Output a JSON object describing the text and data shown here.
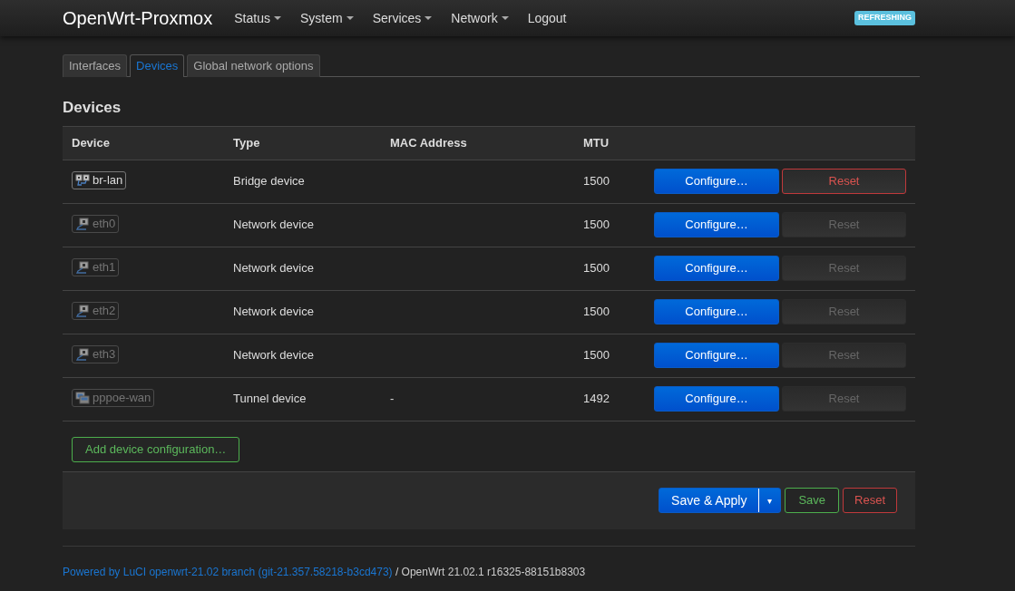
{
  "header": {
    "brand": "OpenWrt-Proxmox",
    "menu": [
      {
        "label": "Status",
        "dropdown": true
      },
      {
        "label": "System",
        "dropdown": true
      },
      {
        "label": "Services",
        "dropdown": true
      },
      {
        "label": "Network",
        "dropdown": true
      },
      {
        "label": "Logout",
        "dropdown": false
      }
    ],
    "badge": "REFRESHING"
  },
  "tabs": [
    {
      "label": "Interfaces",
      "selected": false
    },
    {
      "label": "Devices",
      "selected": true
    },
    {
      "label": "Global network options",
      "selected": false
    }
  ],
  "section_title": "Devices",
  "table": {
    "columns": [
      "Device",
      "Type",
      "MAC Address",
      "MTU"
    ],
    "rows": [
      {
        "device": "br-lan",
        "kind": "bridge",
        "active": true,
        "type": "Bridge device",
        "mac": "",
        "mtu": "1500",
        "configure": "Configure…",
        "reset": "Reset",
        "reset_disabled": false
      },
      {
        "device": "eth0",
        "kind": "ethernet",
        "active": false,
        "type": "Network device",
        "mac": "",
        "mtu": "1500",
        "configure": "Configure…",
        "reset": "Reset",
        "reset_disabled": true
      },
      {
        "device": "eth1",
        "kind": "ethernet",
        "active": false,
        "type": "Network device",
        "mac": "",
        "mtu": "1500",
        "configure": "Configure…",
        "reset": "Reset",
        "reset_disabled": true
      },
      {
        "device": "eth2",
        "kind": "ethernet",
        "active": false,
        "type": "Network device",
        "mac": "",
        "mtu": "1500",
        "configure": "Configure…",
        "reset": "Reset",
        "reset_disabled": true
      },
      {
        "device": "eth3",
        "kind": "ethernet",
        "active": false,
        "type": "Network device",
        "mac": "",
        "mtu": "1500",
        "configure": "Configure…",
        "reset": "Reset",
        "reset_disabled": true
      },
      {
        "device": "pppoe-wan",
        "kind": "tunnel",
        "active": false,
        "type": "Tunnel device",
        "mac": "-",
        "mtu": "1492",
        "configure": "Configure…",
        "reset": "Reset",
        "reset_disabled": true
      }
    ]
  },
  "add_button": "Add device configuration…",
  "actions": {
    "save_apply": "Save & Apply",
    "split": "▾",
    "save": "Save",
    "reset": "Reset"
  },
  "footer": {
    "link": "Powered by LuCI openwrt-21.02 branch (git-21.357.58218-b3cd473)",
    "text": " / OpenWrt 21.02.1 r16325-88151b8303"
  }
}
